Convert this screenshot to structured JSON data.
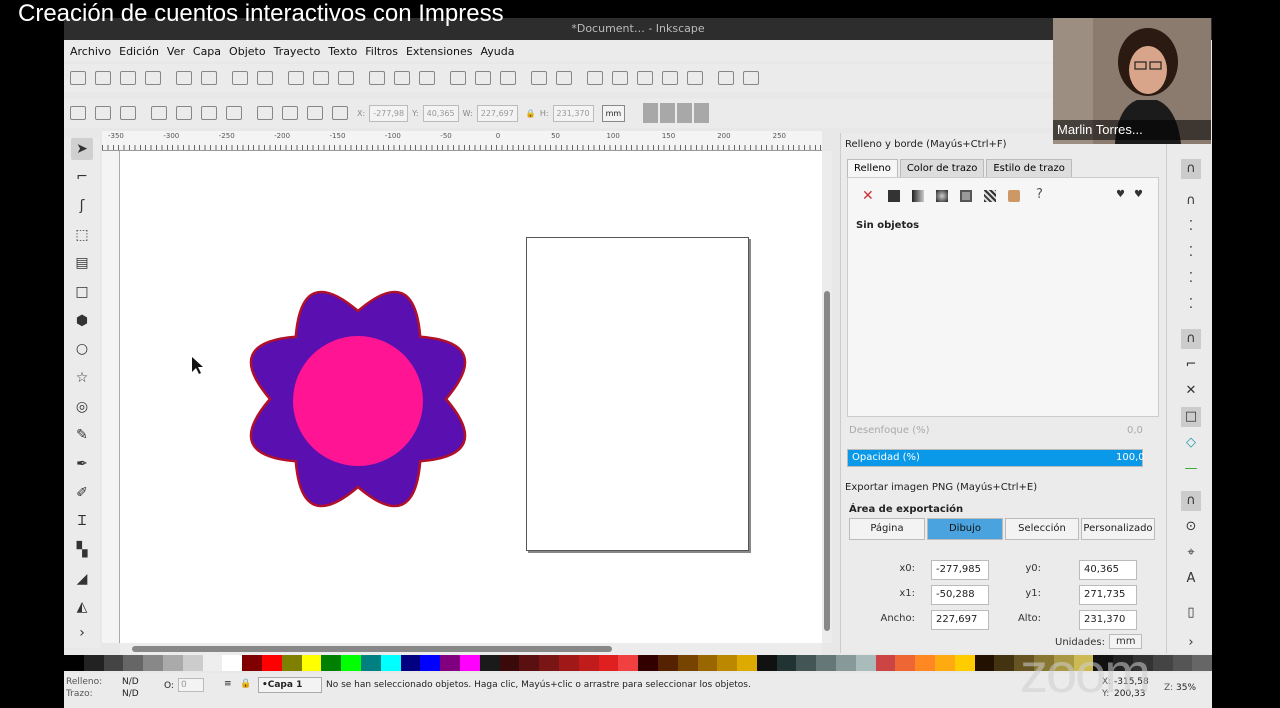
{
  "video_title": "Creación de cuentos interactivos con Impress",
  "window": {
    "title": "*Document…  - Inkscape"
  },
  "menu": [
    "Archivo",
    "Edición",
    "Ver",
    "Capa",
    "Objeto",
    "Trayecto",
    "Texto",
    "Filtros",
    "Extensiones",
    "Ayuda"
  ],
  "toolbar2": {
    "x_label": "X:",
    "x": "-277,98",
    "y_label": "Y:",
    "y": "40,365",
    "w_label": "W:",
    "w": "227,697",
    "h_label": "H:",
    "h": "231,370",
    "unit": "mm"
  },
  "ruler_ticks": [
    "-350",
    "-300",
    "-250",
    "-200",
    "-150",
    "-100",
    "-50",
    "0",
    "50",
    "100",
    "150",
    "200",
    "250"
  ],
  "fill_stroke": {
    "title": "Relleno y borde (Mayús+Ctrl+F)",
    "tabs": [
      "Relleno",
      "Color de trazo",
      "Estilo de trazo"
    ],
    "no_objects": "Sin objetos",
    "blur_label": "Desenfoque (%)",
    "blur_value": "0,0",
    "opacity_label": "Opacidad (%)",
    "opacity_value": "100,0"
  },
  "export": {
    "title": "Exportar imagen PNG (Mayús+Ctrl+E)",
    "area_label": "Área de exportación",
    "buttons": [
      "Página",
      "Dibujo",
      "Selección",
      "Personalizado"
    ],
    "x0_label": "x0:",
    "x0": "-277,985",
    "y0_label": "y0:",
    "y0": "40,365",
    "x1_label": "x1:",
    "x1": "-50,288",
    "y1_label": "y1:",
    "y1": "271,735",
    "width_label": "Ancho:",
    "width": "227,697",
    "height_label": "Alto:",
    "height": "231,370",
    "units_label": "Unidades:",
    "units": "mm"
  },
  "status": {
    "fill_label": "Relleno:",
    "fill_value": "N/D",
    "stroke_label": "Trazo:",
    "stroke_value": "N/D",
    "opacity_label": "O:",
    "opacity_value": "0",
    "layer": "•Capa 1",
    "message": "No se han seleccionado objetos. Haga clic, Mayús+clic o arrastre para seleccionar los objetos.",
    "x_label": "X:",
    "x": "-315,58",
    "y_label": "Y:",
    "y": "200,33",
    "z_label": "Z:",
    "zoom": "35%"
  },
  "webcam": {
    "name": "Marlin Torres..."
  },
  "watermark": "zoom",
  "colors": {
    "flower_petals": "#5a0fb0",
    "flower_stroke": "#b0102a",
    "flower_center": "#ff1493",
    "opacity_bar": "#0a99e8"
  }
}
